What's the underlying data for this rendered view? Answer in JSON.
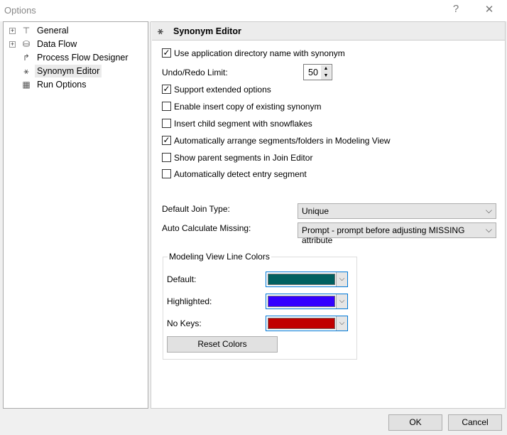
{
  "window": {
    "title": "Options",
    "help": "?",
    "close": "✕"
  },
  "tree": [
    {
      "label": "General",
      "expandable": true
    },
    {
      "label": "Data Flow",
      "expandable": true
    },
    {
      "label": "Process Flow Designer",
      "expandable": false
    },
    {
      "label": "Synonym Editor",
      "expandable": false,
      "selected": true
    },
    {
      "label": "Run Options",
      "expandable": false
    }
  ],
  "panel": {
    "title": "Synonym Editor",
    "use_app_dir": {
      "label": "Use application directory name with synonym",
      "checked": true
    },
    "undo_label": "Undo/Redo Limit:",
    "undo_value": "50",
    "options": [
      {
        "label": "Support extended options",
        "checked": true
      },
      {
        "label": "Enable insert copy of existing synonym",
        "checked": false
      },
      {
        "label": "Insert child segment with snowflakes",
        "checked": false
      },
      {
        "label": "Automatically arrange segments/folders in Modeling View",
        "checked": true
      },
      {
        "label": "Show parent segments in Join Editor",
        "checked": false
      },
      {
        "label": "Automatically detect entry segment",
        "checked": false
      }
    ],
    "join_label": "Default Join Type:",
    "join_value": "Unique",
    "missing_label": "Auto Calculate Missing:",
    "missing_value": "Prompt - prompt before adjusting MISSING attribute",
    "group_label": "Modeling View Line Colors",
    "colors": [
      {
        "label": "Default:",
        "color": "#006060"
      },
      {
        "label": "Highlighted:",
        "color": "#3300ff"
      },
      {
        "label": "No Keys:",
        "color": "#c00000"
      }
    ],
    "reset_label": "Reset Colors"
  },
  "buttons": {
    "ok": "OK",
    "cancel": "Cancel"
  }
}
